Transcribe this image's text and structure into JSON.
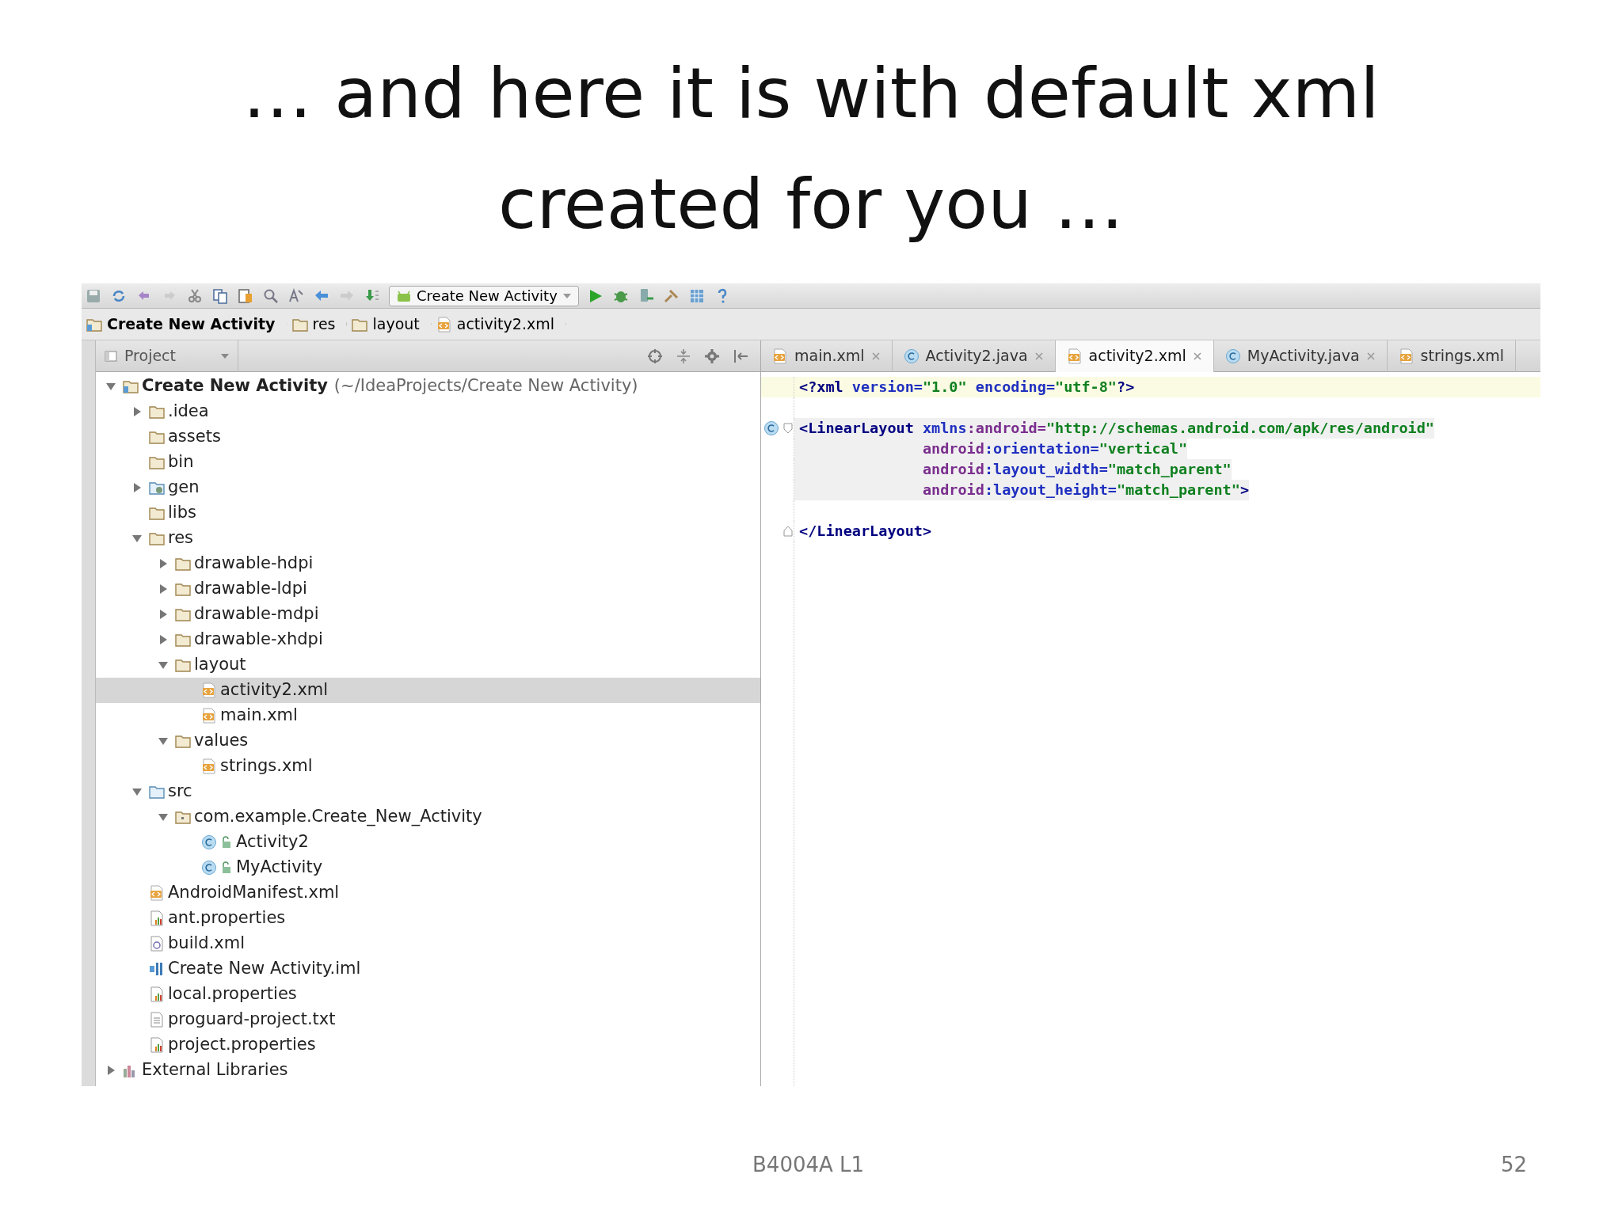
{
  "slide": {
    "title": "… and here it is with default xml created for you …",
    "footer": "B4004A L1",
    "page_number": "52"
  },
  "ide": {
    "toolbar": {
      "run_config": "Create New Activity"
    },
    "breadcrumbs": [
      {
        "label": "Create New Activity",
        "kind": "project"
      },
      {
        "label": "res",
        "kind": "folder"
      },
      {
        "label": "layout",
        "kind": "folder"
      },
      {
        "label": "activity2.xml",
        "kind": "xml"
      }
    ],
    "project_panel": {
      "view": "Project",
      "tree": [
        {
          "label": "Create New Activity",
          "path": "(~/IdeaProjects/Create New Activity)",
          "kind": "project",
          "expanded": true,
          "selected": false,
          "children": [
            {
              "label": ".idea",
              "kind": "folder",
              "expanded": false,
              "selected": false
            },
            {
              "label": "assets",
              "kind": "folder",
              "selected": false
            },
            {
              "label": "bin",
              "kind": "folder",
              "selected": false
            },
            {
              "label": "gen",
              "kind": "gen",
              "expanded": false,
              "selected": false
            },
            {
              "label": "libs",
              "kind": "folder",
              "selected": false
            },
            {
              "label": "res",
              "kind": "folder",
              "expanded": true,
              "selected": false,
              "children": [
                {
                  "label": "drawable-hdpi",
                  "kind": "folder",
                  "expanded": false,
                  "selected": false
                },
                {
                  "label": "drawable-ldpi",
                  "kind": "folder",
                  "expanded": false,
                  "selected": false
                },
                {
                  "label": "drawable-mdpi",
                  "kind": "folder",
                  "expanded": false,
                  "selected": false
                },
                {
                  "label": "drawable-xhdpi",
                  "kind": "folder",
                  "expanded": false,
                  "selected": false
                },
                {
                  "label": "layout",
                  "kind": "folder",
                  "expanded": true,
                  "selected": false,
                  "children": [
                    {
                      "label": "activity2.xml",
                      "kind": "xml",
                      "selected": true
                    },
                    {
                      "label": "main.xml",
                      "kind": "xml",
                      "selected": false
                    }
                  ]
                },
                {
                  "label": "values",
                  "kind": "folder",
                  "expanded": true,
                  "selected": false,
                  "children": [
                    {
                      "label": "strings.xml",
                      "kind": "xml",
                      "selected": false
                    }
                  ]
                }
              ]
            },
            {
              "label": "src",
              "kind": "source",
              "expanded": true,
              "selected": false,
              "children": [
                {
                  "label": "com.example.Create_New_Activity",
                  "kind": "package",
                  "expanded": true,
                  "selected": false,
                  "children": [
                    {
                      "label": "Activity2",
                      "kind": "class",
                      "selected": false
                    },
                    {
                      "label": "MyActivity",
                      "kind": "class",
                      "selected": false
                    }
                  ]
                }
              ]
            },
            {
              "label": "AndroidManifest.xml",
              "kind": "xml",
              "selected": false
            },
            {
              "label": "ant.properties",
              "kind": "properties",
              "selected": false
            },
            {
              "label": "build.xml",
              "kind": "build",
              "selected": false
            },
            {
              "label": "Create New Activity.iml",
              "kind": "iml",
              "selected": false
            },
            {
              "label": "local.properties",
              "kind": "properties",
              "selected": false
            },
            {
              "label": "proguard-project.txt",
              "kind": "text",
              "selected": false
            },
            {
              "label": "project.properties",
              "kind": "properties",
              "selected": false
            }
          ]
        },
        {
          "label": "External Libraries",
          "kind": "library",
          "expanded": false,
          "selected": false
        }
      ]
    },
    "editor": {
      "tabs": [
        {
          "label": "main.xml",
          "kind": "xml",
          "selected": false
        },
        {
          "label": "Activity2.java",
          "kind": "class",
          "selected": false
        },
        {
          "label": "activity2.xml",
          "kind": "xml",
          "selected": true
        },
        {
          "label": "MyActivity.java",
          "kind": "class",
          "selected": false
        },
        {
          "label": "strings.xml",
          "kind": "xml",
          "selected": false
        }
      ],
      "lines": [
        {
          "current": true,
          "highlighted": false,
          "tokens": [
            {
              "text": "<?xml",
              "kind": "tag"
            },
            {
              "text": " version",
              "kind": "attr"
            },
            {
              "text": "=",
              "kind": "attr"
            },
            {
              "text": "\"1.0\"",
              "kind": "value"
            },
            {
              "text": " encoding",
              "kind": "attr"
            },
            {
              "text": "=",
              "kind": "attr"
            },
            {
              "text": "\"utf-8\"",
              "kind": "value"
            },
            {
              "text": "?>",
              "kind": "tag"
            }
          ]
        },
        {
          "current": false,
          "highlighted": false
        },
        {
          "current": false,
          "highlighted": true,
          "class_marker": true,
          "fold_start": true,
          "tokens": [
            {
              "text": "<LinearLayout",
              "kind": "tag"
            },
            {
              "text": " xmlns",
              "kind": "attr"
            },
            {
              "text": ":android=",
              "kind": "ns"
            },
            {
              "text": "\"http://schemas.android.com/apk/res/android\"",
              "kind": "value"
            }
          ]
        },
        {
          "current": false,
          "highlighted": true,
          "indent": true,
          "tokens": [
            {
              "text": "android",
              "kind": "ns"
            },
            {
              "text": ":orientation=",
              "kind": "attr"
            },
            {
              "text": "\"vertical\"",
              "kind": "value"
            }
          ]
        },
        {
          "current": false,
          "highlighted": true,
          "indent": true,
          "tokens": [
            {
              "text": "android",
              "kind": "ns"
            },
            {
              "text": ":layout_width=",
              "kind": "attr"
            },
            {
              "text": "\"match_parent\"",
              "kind": "value"
            }
          ]
        },
        {
          "current": false,
          "highlighted": true,
          "indent": true,
          "tokens": [
            {
              "text": "android",
              "kind": "ns"
            },
            {
              "text": ":layout_height=",
              "kind": "attr"
            },
            {
              "text": "\"match_parent\"",
              "kind": "value"
            },
            {
              "text": ">",
              "kind": "tag"
            }
          ]
        },
        {
          "current": false,
          "highlighted": false
        },
        {
          "current": false,
          "highlighted": false,
          "fold_end": true,
          "tokens": [
            {
              "text": "</LinearLayout>",
              "kind": "tag"
            }
          ]
        }
      ]
    }
  }
}
